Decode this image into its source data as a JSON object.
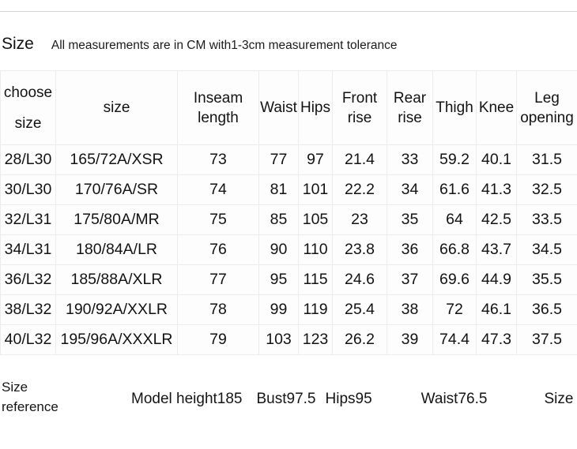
{
  "heading": {
    "title": "Size",
    "note": "All measurements are in CM with1-3cm measurement tolerance"
  },
  "table": {
    "headers": {
      "choose_line1": "choose",
      "choose_line2": "size",
      "size": "size",
      "inseam_line1": "Inseam",
      "inseam_line2": "length",
      "waist": "Waist",
      "hips": "Hips",
      "front_line1": "Front",
      "front_line2": "rise",
      "rear_line1": "Rear",
      "rear_line2": "rise",
      "thigh": "Thigh",
      "knee": "Knee",
      "leg_line1": "Leg",
      "leg_line2": "opening"
    },
    "rows": [
      {
        "choose": "28/L30",
        "size": "165/72A/XSR",
        "inseam": "73",
        "waist": "77",
        "hips": "97",
        "front_rise": "21.4",
        "rear_rise": "33",
        "thigh": "59.2",
        "knee": "40.1",
        "leg_opening": "31.5"
      },
      {
        "choose": "30/L30",
        "size": "170/76A/SR",
        "inseam": "74",
        "waist": "81",
        "hips": "101",
        "front_rise": "22.2",
        "rear_rise": "34",
        "thigh": "61.6",
        "knee": "41.3",
        "leg_opening": "32.5"
      },
      {
        "choose": "32/L31",
        "size": "175/80A/MR",
        "inseam": "75",
        "waist": "85",
        "hips": "105",
        "front_rise": "23",
        "rear_rise": "35",
        "thigh": "64",
        "knee": "42.5",
        "leg_opening": "33.5"
      },
      {
        "choose": "34/L31",
        "size": "180/84A/LR",
        "inseam": "76",
        "waist": "90",
        "hips": "110",
        "front_rise": "23.8",
        "rear_rise": "36",
        "thigh": "66.8",
        "knee": "43.7",
        "leg_opening": "34.5"
      },
      {
        "choose": "36/L32",
        "size": "185/88A/XLR",
        "inseam": "77",
        "waist": "95",
        "hips": "115",
        "front_rise": "24.6",
        "rear_rise": "37",
        "thigh": "69.6",
        "knee": "44.9",
        "leg_opening": "35.5"
      },
      {
        "choose": "38/L32",
        "size": "190/92A/XXLR",
        "inseam": "78",
        "waist": "99",
        "hips": "119",
        "front_rise": "25.4",
        "rear_rise": "38",
        "thigh": "72",
        "knee": "46.1",
        "leg_opening": "36.5"
      },
      {
        "choose": "40/L32",
        "size": "195/96A/XXXLR",
        "inseam": "79",
        "waist": "103",
        "hips": "123",
        "front_rise": "26.2",
        "rear_rise": "39",
        "thigh": "74.4",
        "knee": "47.3",
        "leg_opening": "37.5"
      }
    ]
  },
  "size_reference": {
    "label_line1": "Size",
    "label_line2": "reference",
    "model_height": "Model height185",
    "bust": "Bust97.5",
    "hips": "Hips95",
    "waist": "Waist76.5",
    "size": "Size M"
  }
}
